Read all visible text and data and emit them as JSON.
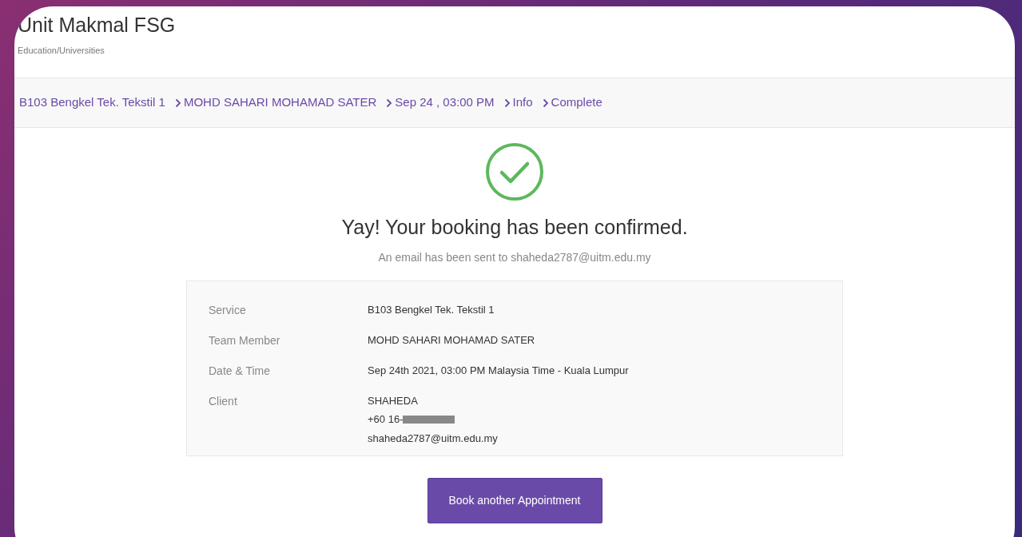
{
  "header": {
    "title": "Unit Makmal FSG",
    "subtitle": "Education/Universities"
  },
  "breadcrumb": [
    {
      "label": "B103 Bengkel Tek. Tekstil 1"
    },
    {
      "label": "MOHD SAHARI MOHAMAD SATER"
    },
    {
      "label": "Sep 24 , 03:00 PM"
    },
    {
      "label": "Info"
    },
    {
      "label": "Complete"
    }
  ],
  "confirmation": {
    "heading": "Yay! Your booking has been confirmed.",
    "message": "An email has been sent to shaheda2787@uitm.edu.my"
  },
  "details": [
    {
      "label": "Service",
      "lines": [
        {
          "text": "B103 Bengkel Tek. Tekstil 1",
          "redacted": false
        }
      ]
    },
    {
      "label": "Team Member",
      "lines": [
        {
          "text": "MOHD SAHARI MOHAMAD SATER",
          "redacted": false
        }
      ]
    },
    {
      "label": "Date & Time",
      "lines": [
        {
          "text": "Sep 24th 2021, 03:00 PM Malaysia Time - Kuala Lumpur",
          "redacted": false
        }
      ]
    },
    {
      "label": "Client",
      "lines": [
        {
          "text": "SHAHEDA",
          "redacted": false
        },
        {
          "text": "+60 16-",
          "redacted": true
        },
        {
          "text": "shaheda2787@uitm.edu.my",
          "redacted": false
        }
      ]
    }
  ],
  "button": {
    "label": "Book another Appointment"
  }
}
